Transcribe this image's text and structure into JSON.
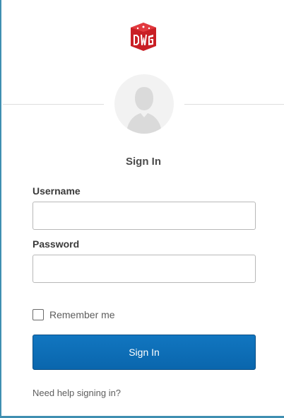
{
  "header": {
    "logo_name": "dwg-logo",
    "logo_color": "#c91f25",
    "logo_text": "DWG"
  },
  "form": {
    "title": "Sign In",
    "username_label": "Username",
    "username_value": "",
    "password_label": "Password",
    "password_value": "",
    "remember_label": "Remember me",
    "remember_checked": false,
    "submit_label": "Sign In",
    "help_link": "Need help signing in?"
  },
  "colors": {
    "accent": "#0d6fb8",
    "frame_border": "#3f8fb1"
  }
}
